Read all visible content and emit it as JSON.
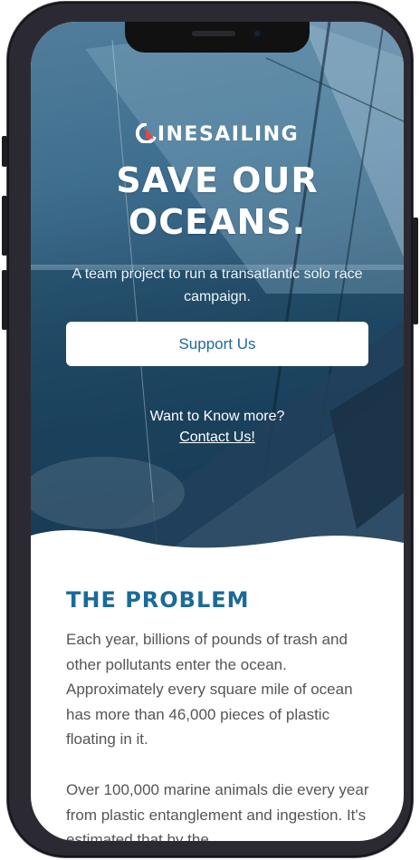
{
  "brand": {
    "logo_text": "INESAILING",
    "logo_initial": "C"
  },
  "hero": {
    "headline_line1": "SAVE OUR",
    "headline_line2": "OCEANS.",
    "subtitle": "A team project to run a transatlantic solo race campaign.",
    "support_label": "Support Us",
    "know_more": "Want to Know more?",
    "contact_label": "Contact Us!"
  },
  "problem": {
    "title": "THE PROBLEM",
    "paragraph1": "Each year, billions of pounds of trash and other pollutants enter the ocean. Approximately every square mile of ocean has more than 46,000 pieces of plastic floating in it.",
    "paragraph2": "Over 100,000 marine animals die every year from plastic entanglement and ingestion. It's estimated that by the"
  },
  "colors": {
    "accent": "#1b6a9a",
    "logo_mark": "#e0484f",
    "body_text": "#555555"
  }
}
